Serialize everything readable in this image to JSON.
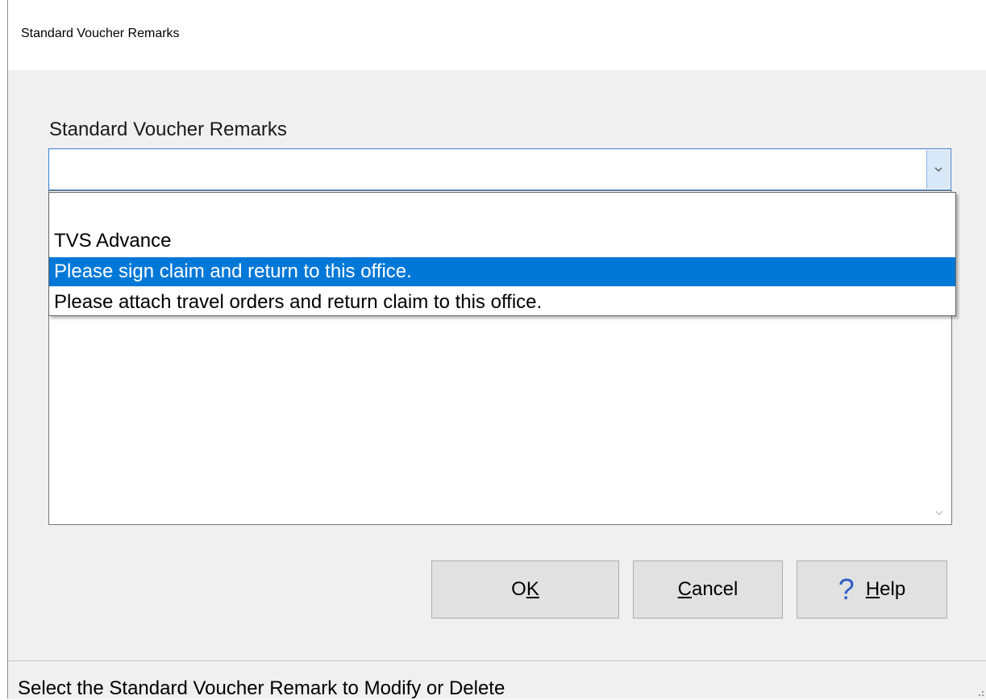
{
  "window": {
    "title": "Standard Voucher Remarks"
  },
  "form": {
    "label": "Standard Voucher Remarks",
    "combo_value": "",
    "dropdown_items": [
      "",
      "TVS Advance",
      "Please sign claim and return to this office.",
      "Please attach travel orders and return claim to this office."
    ],
    "selected_index": 2,
    "remarks_text": ""
  },
  "buttons": {
    "ok_prefix": "O",
    "ok_accel": "K",
    "ok_suffix": "",
    "cancel_accel": "C",
    "cancel_suffix": "ancel",
    "help_icon": "?",
    "help_accel": "H",
    "help_suffix": "elp"
  },
  "status": {
    "text": "Select the Standard Voucher Remark to Modify or Delete"
  },
  "colors": {
    "accent": "#0078d7",
    "help_icon": "#2f5ec9"
  }
}
